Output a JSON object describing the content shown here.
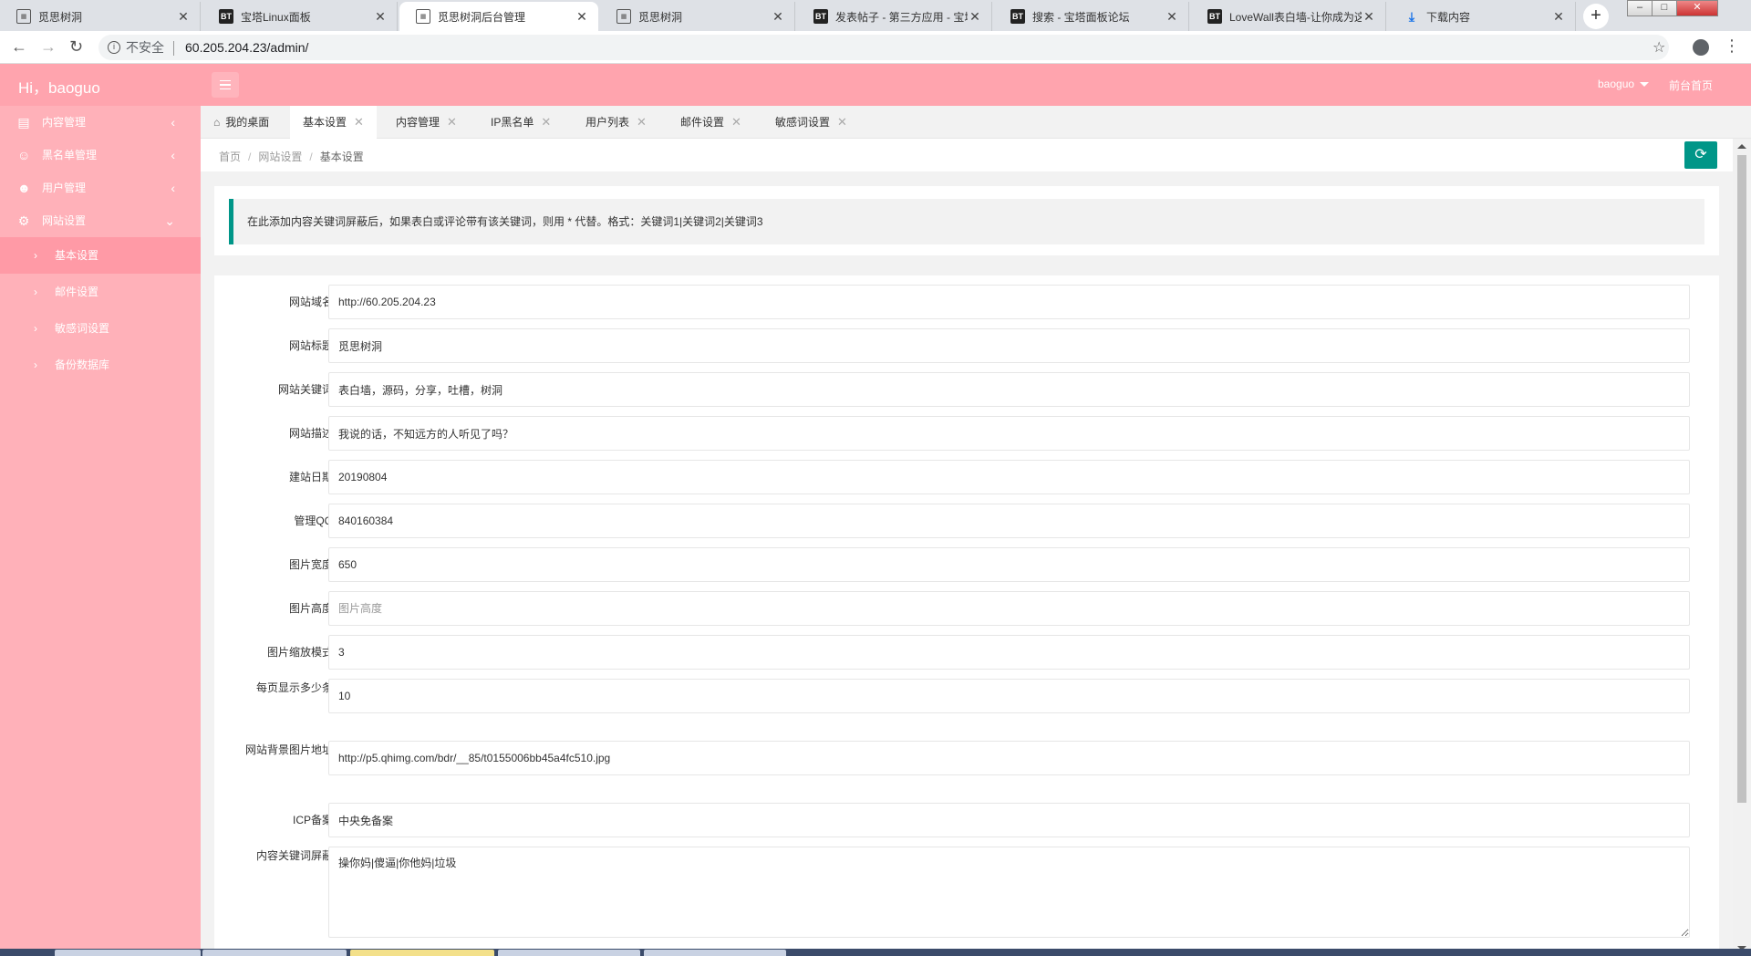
{
  "browser": {
    "tabs": [
      {
        "title": "觅思树洞",
        "favicon": "site",
        "active": false
      },
      {
        "title": "宝塔Linux面板",
        "favicon": "bt",
        "active": false
      },
      {
        "title": "觅思树洞后台管理",
        "favicon": "site",
        "active": true
      },
      {
        "title": "觅思树洞",
        "favicon": "site",
        "active": false
      },
      {
        "title": "发表帖子 - 第三方应用 - 宝塔",
        "favicon": "bt",
        "active": false
      },
      {
        "title": "搜索 - 宝塔面板论坛",
        "favicon": "bt",
        "active": false
      },
      {
        "title": "LoveWall表白墙-让你成为这",
        "favicon": "bt",
        "active": false
      },
      {
        "title": "下载内容",
        "favicon": "download",
        "active": false
      }
    ],
    "security_label": "不安全",
    "url": "60.205.204.23/admin/"
  },
  "header": {
    "greeting": "Hi，baoguo",
    "user_menu": "baoguo",
    "front_link": "前台首页",
    "color": "#ffa4ae"
  },
  "sidebar": {
    "items": [
      {
        "label": "内容管理",
        "icon": "document-icon",
        "expanded": false
      },
      {
        "label": "黑名单管理",
        "icon": "user-icon",
        "expanded": false
      },
      {
        "label": "用户管理",
        "icon": "users-icon",
        "expanded": false
      },
      {
        "label": "网站设置",
        "icon": "gear-icon",
        "expanded": true
      }
    ],
    "subitems": [
      {
        "label": "基本设置",
        "active": true
      },
      {
        "label": "邮件设置",
        "active": false
      },
      {
        "label": "敏感词设置",
        "active": false
      },
      {
        "label": "备份数据库",
        "active": false
      }
    ]
  },
  "page_tabs": [
    {
      "label": "我的桌面",
      "active": false,
      "closable": false
    },
    {
      "label": "基本设置",
      "active": true,
      "closable": true
    },
    {
      "label": "内容管理",
      "active": false,
      "closable": true
    },
    {
      "label": "IP黑名单",
      "active": false,
      "closable": true
    },
    {
      "label": "用户列表",
      "active": false,
      "closable": true
    },
    {
      "label": "邮件设置",
      "active": false,
      "closable": true
    },
    {
      "label": "敏感词设置",
      "active": false,
      "closable": true
    }
  ],
  "breadcrumb": [
    "首页",
    "网站设置",
    "基本设置"
  ],
  "notice": "在此添加内容关键词屏蔽后，如果表白或评论带有该关键词，则用 * 代替。格式：关键词1|关键词2|关键词3",
  "accent_color": "#009688",
  "form": {
    "fields": [
      {
        "label": "网站域名",
        "value": "http://60.205.204.23",
        "placeholder": ""
      },
      {
        "label": "网站标题",
        "value": "觅思树洞",
        "placeholder": ""
      },
      {
        "label": "网站关键词",
        "value": "表白墙，源码，分享，吐槽，树洞",
        "placeholder": ""
      },
      {
        "label": "网站描述",
        "value": "我说的话，不知远方的人听见了吗？",
        "placeholder": ""
      },
      {
        "label": "建站日期",
        "value": "20190804",
        "placeholder": ""
      },
      {
        "label": "管理QQ",
        "value": "840160384",
        "placeholder": ""
      },
      {
        "label": "图片宽度",
        "value": "650",
        "placeholder": ""
      },
      {
        "label": "图片高度",
        "value": "",
        "placeholder": "图片高度"
      },
      {
        "label": "图片缩放模式",
        "value": "3",
        "placeholder": ""
      },
      {
        "label": "每页显示多少条",
        "value": "10",
        "placeholder": ""
      },
      {
        "label": "网站背景图片地址",
        "value": "http://p5.qhimg.com/bdr/__85/t0155006bb45a4fc510.jpg",
        "placeholder": ""
      },
      {
        "label": "ICP备案",
        "value": "中央免备案",
        "placeholder": ""
      }
    ],
    "textarea": {
      "label": "内容关键词屏蔽",
      "value": "操你妈|傻逼|你他妈|垃圾"
    }
  }
}
